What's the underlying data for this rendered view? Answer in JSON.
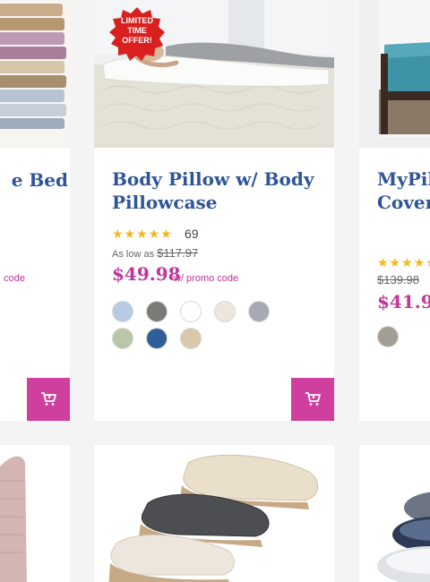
{
  "products": {
    "left": {
      "title_fragment": "e Bed",
      "promo_fragment": "code",
      "cart_label": "Add to cart"
    },
    "middle": {
      "badge": [
        "LIMITED",
        "TIME",
        "OFFER!"
      ],
      "title_line1": "Body Pillow w/ Body",
      "title_line2": "Pillowcase",
      "rating": 5,
      "review_count": "69",
      "as_low_as_label": "As low as",
      "original_price": "$117.97",
      "sale_price": "$49.98",
      "promo_text": "w/ promo code",
      "swatches": [
        "#b8cbe4",
        "#7a7b76",
        "#ffffff",
        "#ebe7dc",
        "#a6aab4",
        "#b7c7a7",
        "#2f5f98",
        "#dac8ab"
      ],
      "cart_label": "Add to cart"
    },
    "right": {
      "title_line1": "MyPil",
      "title_line2": "Cover",
      "rating": 5,
      "original_price": "$139.98",
      "sale_price": "$41.99",
      "swatches": [
        "#a39e93"
      ]
    }
  },
  "colors": {
    "accent": "#cf3f9e",
    "title_blue": "#2f5597",
    "price_pink": "#c0369a",
    "star_gold": "#f4b81a"
  }
}
